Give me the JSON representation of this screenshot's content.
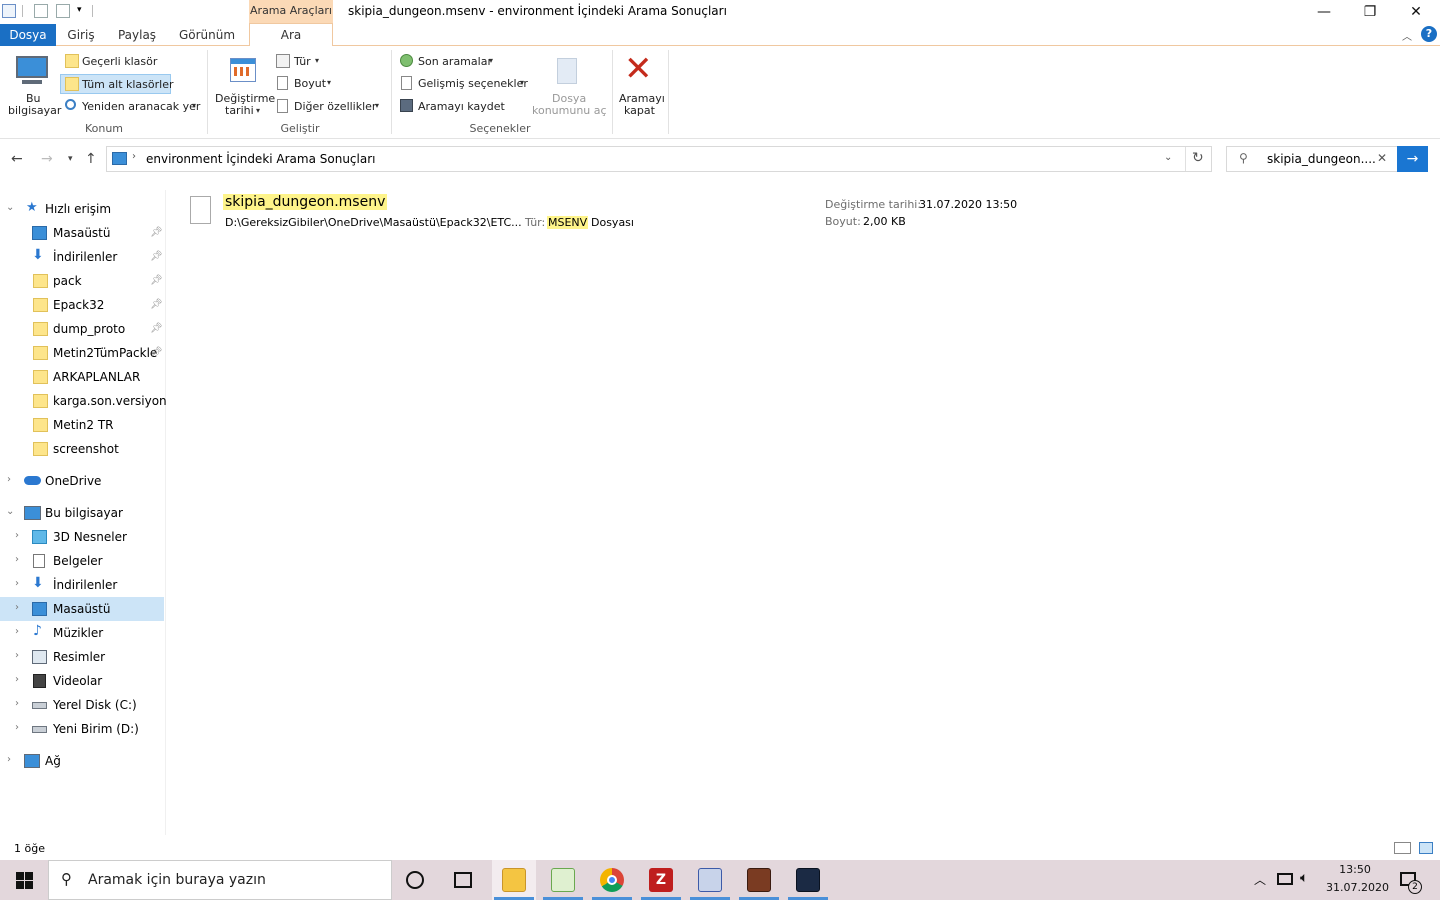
{
  "window": {
    "title": "skipia_dungeon.msenv - environment İçindeki Arama Sonuçları",
    "context_tab_header": "Arama Araçları",
    "minimize": "—",
    "maximize": "❐",
    "close": "✕"
  },
  "tabs": [
    "Dosya",
    "Giriş",
    "Paylaş",
    "Görünüm",
    "Ara"
  ],
  "ribbon": {
    "konum": {
      "label": "Konum",
      "bu_bilgisayar": [
        "Bu",
        "bilgisayar"
      ],
      "gecerli_klasor": "Geçerli klasör",
      "tum_alt_klasorler": "Tüm alt klasörler",
      "yeniden_aranacak_yer": "Yeniden aranacak yer"
    },
    "gelistir": {
      "label": "Geliştir",
      "degistirme_tarihi": [
        "Değiştirme",
        "tarihi"
      ],
      "tur": "Tür",
      "boyut": "Boyut",
      "diger_ozellikler": "Diğer özellikler"
    },
    "secenekler": {
      "label": "Seçenekler",
      "son_aramalar": "Son aramalar",
      "gelismis_secenekler": "Gelişmiş seçenekler",
      "aramayi_kaydet": "Aramayı kaydet",
      "dosya_konumunu_ac": [
        "Dosya",
        "konumunu aç"
      ],
      "aramayi_kapat": [
        "Aramayı",
        "kapat"
      ]
    }
  },
  "address": {
    "path": "environment İçindeki Arama Sonuçları",
    "search_value": "skipia_dungeon...."
  },
  "navpane": {
    "quick_access": "Hızlı erişim",
    "quick_items": [
      {
        "label": "Masaüstü",
        "icon": "desktop-icon",
        "pinned": true
      },
      {
        "label": "İndirilenler",
        "icon": "download-icon",
        "pinned": true
      },
      {
        "label": "pack",
        "icon": "folder-icon",
        "pinned": true
      },
      {
        "label": "Epack32",
        "icon": "folder-icon",
        "pinned": true
      },
      {
        "label": "dump_proto",
        "icon": "folder-icon",
        "pinned": true
      },
      {
        "label": "Metin2TümPackle",
        "icon": "folder-icon",
        "pinned": true
      },
      {
        "label": "ARKAPLANLAR",
        "icon": "folder-icon",
        "pinned": false
      },
      {
        "label": "karga.son.versiyon",
        "icon": "folder-icon",
        "pinned": false
      },
      {
        "label": "Metin2 TR",
        "icon": "folder-icon",
        "pinned": false
      },
      {
        "label": "screenshot",
        "icon": "folder-icon",
        "pinned": false
      }
    ],
    "onedrive": "OneDrive",
    "this_pc": "Bu bilgisayar",
    "pc_items": [
      {
        "label": "3D Nesneler",
        "icon": "3d-objects-icon"
      },
      {
        "label": "Belgeler",
        "icon": "documents-icon"
      },
      {
        "label": "İndirilenler",
        "icon": "download-icon"
      },
      {
        "label": "Masaüstü",
        "icon": "desktop-icon",
        "selected": true
      },
      {
        "label": "Müzikler",
        "icon": "music-icon"
      },
      {
        "label": "Resimler",
        "icon": "pictures-icon"
      },
      {
        "label": "Videolar",
        "icon": "videos-icon"
      },
      {
        "label": "Yerel Disk (C:)",
        "icon": "local-disk-icon"
      },
      {
        "label": "Yeni Birim (D:)",
        "icon": "drive-icon"
      }
    ],
    "network": "Ağ"
  },
  "result": {
    "filename": "skipia_dungeon.msenv",
    "path": "D:\\GereksizGibiler\\OneDrive\\Masaüstü\\Epack32\\ETC...",
    "type_label": "Tür:",
    "type_ext": "MSENV",
    "type_rest": "Dosyası",
    "modified_label": "Değiştirme tarihi:",
    "modified_value": "31.07.2020 13:50",
    "size_label": "Boyut:",
    "size_value": "2,00 KB"
  },
  "status": {
    "count": "1 öğe"
  },
  "taskbar": {
    "search_placeholder": "Aramak için buraya yazın",
    "time": "13:50",
    "date": "31.07.2020",
    "notification_count": "2"
  },
  "colors": {
    "accent": "#1a6fc4",
    "context_tab": "#fbd9b6",
    "highlight": "#fef48a",
    "selection": "#cce4f7",
    "taskbar": "#e3d7dc"
  }
}
